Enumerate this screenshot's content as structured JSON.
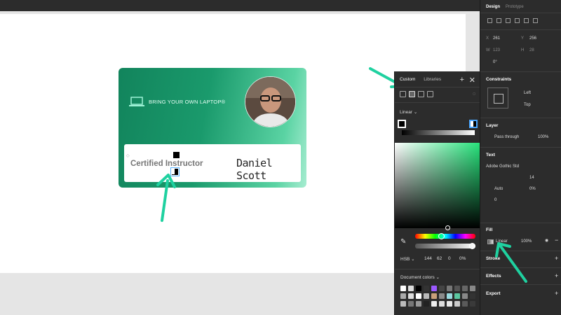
{
  "ruler": {
    "ticks": [
      "",
      "",
      "",
      "",
      "",
      "",
      "",
      "",
      ""
    ]
  },
  "card": {
    "brand": "BRING YOUR OWN LAPTOP®",
    "cert_text": "Certified Instructor",
    "signature": "Daniel Scott"
  },
  "picker": {
    "tab_custom": "Custom",
    "tab_libraries": "Libraries",
    "plus": "+",
    "close": "✕",
    "gradient_type": "Linear ⌄",
    "mode": "HSB ⌄",
    "h": "144",
    "s": "62",
    "b": "0",
    "a": "0%",
    "doc_colors": "Document colors ⌄",
    "swatches": [
      "#ffffff",
      "#dddddd",
      "#000000",
      "#333333",
      "#9b59ff",
      "#444444",
      "#777777",
      "#555555",
      "#666666",
      "#888888",
      "#aaaaaa",
      "#dddddd",
      "#ffffff",
      "#b9b9b9",
      "#c8a07a",
      "#8a8a8a",
      "#9adbe0",
      "#5ac7a0",
      "#888888",
      "#333333",
      "#bbbbbb",
      "#777777",
      "#999999",
      "#222222",
      "#eeeeee",
      "#dddddd",
      "#e8e8e8",
      "#cccccc",
      "#5a5a5a",
      "#3a3a3a"
    ]
  },
  "panel": {
    "tab_design": "Design",
    "tab_prototype": "Prototype",
    "x_label": "X",
    "x_value": "261",
    "y_label": "Y",
    "y_value": "256",
    "w_label": "W",
    "w_value": "123",
    "h_label": "H",
    "h_value": "28",
    "rotation": "0°",
    "constraints_title": "Constraints",
    "constraint_h": "Left",
    "constraint_v": "Top",
    "layer_title": "Layer",
    "blend": "Pass through",
    "opacity": "100%",
    "text_title": "Text",
    "font": "Adobe Gothic Std",
    "font_size": "14",
    "line_height": "Auto",
    "letter_spacing": "0%",
    "para_spacing": "0",
    "fill_title": "Fill",
    "fill_type": "Linear",
    "fill_opacity": "100%",
    "stroke_title": "Stroke",
    "effects_title": "Effects",
    "export_title": "Export"
  }
}
